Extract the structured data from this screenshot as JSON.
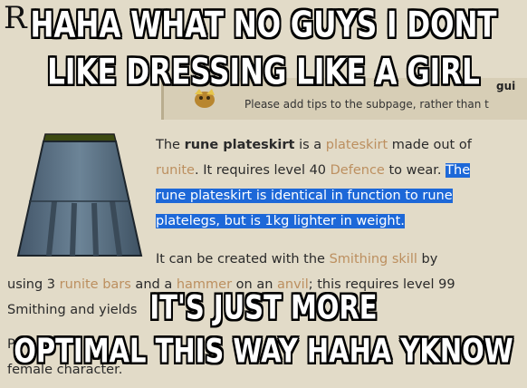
{
  "page": {
    "title_fragment": "R"
  },
  "tip": {
    "title_fragment": "gui",
    "note": "Please add tips to the subpage, rather than t"
  },
  "article": {
    "p1_the": "The ",
    "p1_item": "rune plateskirt",
    "p1_is_a": " is a ",
    "p1_link_plateskirt": "plateskirt",
    "p1_made_of": " made out of",
    "p1_link_runite": "runite",
    "p1_requires": ". It requires level 40 ",
    "p1_link_defence": "Defence",
    "p1_to_wear": " to wear. ",
    "p1_highlight_a": "The",
    "p1_highlight_b": "rune plateskirt is identical in function to rune",
    "p1_highlight_c": "platelegs, but is 1kg lighter in weight.",
    "p2_created": "It can be created with the ",
    "p2_link_smithing": "Smithing skill",
    "p2_by": " by",
    "p3_using": "using 3 ",
    "p3_link_bars": "runite bars",
    "p3_and_a": " and a ",
    "p3_link_hammer": "hammer",
    "p3_on_an": " on an ",
    "p3_link_anvil": "anvil",
    "p3_requires": "; this requires level 99",
    "p4_text": "Smithing and yields",
    "p5_text": "Pl",
    "p6_text": "female character."
  },
  "meme": {
    "top_line1": "HAHA WHAT NO GUYS I DONT",
    "top_line2": "LIKE DRESSING LIKE A GIRL",
    "bottom_line1": "IT'S JUST MORE",
    "bottom_line2": "OPTIMAL THIS WAY HAHA YKNOW"
  }
}
